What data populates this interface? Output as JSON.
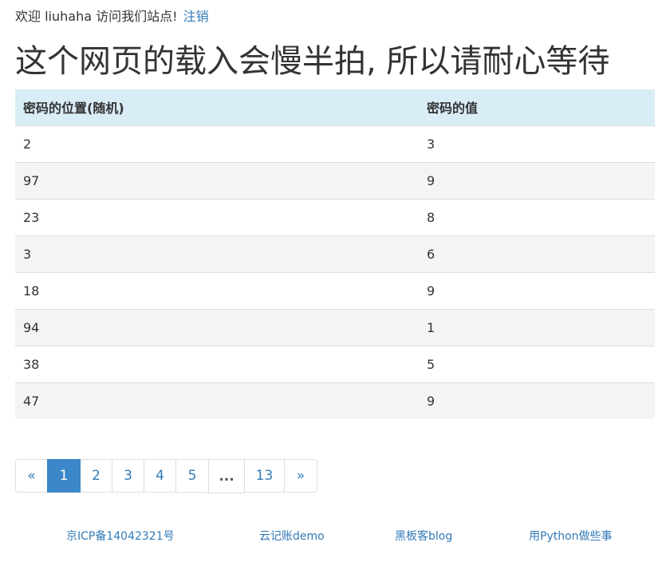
{
  "header": {
    "welcome_text": "欢迎 liuhaha 访问我们站点!",
    "logout_link": "注销"
  },
  "page_title": "这个网页的载入会慢半拍, 所以请耐心等待",
  "table": {
    "headers": [
      "密码的位置(随机)",
      "密码的值"
    ],
    "rows": [
      [
        "2",
        "3"
      ],
      [
        "97",
        "9"
      ],
      [
        "23",
        "8"
      ],
      [
        "3",
        "6"
      ],
      [
        "18",
        "9"
      ],
      [
        "94",
        "1"
      ],
      [
        "38",
        "5"
      ],
      [
        "47",
        "9"
      ]
    ]
  },
  "pagination": {
    "prev": "«",
    "pages": [
      "1",
      "2",
      "3",
      "4",
      "5"
    ],
    "active": "1",
    "ellipsis": "...",
    "last": "13",
    "next": "»"
  },
  "footer": {
    "links": [
      "京ICP备14042321号",
      "云记账demo",
      "黑板客blog",
      "用Python做些事"
    ]
  },
  "colors": {
    "link": "#337ab7",
    "table_header_bg": "#d9edf7",
    "active_page_bg": "#3b87c7",
    "striped_row_bg": "#f4f4f4"
  }
}
